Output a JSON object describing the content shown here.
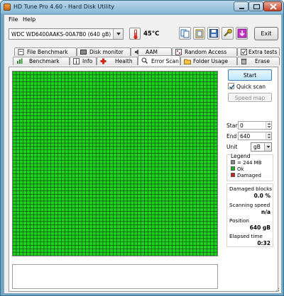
{
  "window": {
    "title": "HD Tune Pro 4.60 - Hard Disk Utility"
  },
  "menu": [
    {
      "label": "File",
      "accel": "F"
    },
    {
      "label": "Help",
      "accel": "H"
    }
  ],
  "toolbar": {
    "drive": "WDC WD6400AAKS-00A7B0 (640 gB)",
    "temperature": "45°C",
    "exit_label": "Exit"
  },
  "tabs_top": [
    "File Benchmark",
    "Disk monitor",
    "AAM",
    "Random Access",
    "Extra tests"
  ],
  "tabs_bottom": [
    "Benchmark",
    "Info",
    "Health",
    "Error Scan",
    "Folder Usage",
    "Erase"
  ],
  "active_tab": "Error Scan",
  "scan": {
    "start_label": "Start",
    "quick_scan_label": "Quick scan",
    "quick_scan_checked": true,
    "speed_map_label": "Speed map",
    "start_field_label": "Start",
    "start_value": "0",
    "end_field_label": "End",
    "end_value": "640",
    "unit_label": "Unit",
    "unit_value": "gB"
  },
  "legend": {
    "title": "Legend",
    "items": [
      {
        "label": "= 244 MB",
        "color": "#8c8c8c"
      },
      {
        "label": "Ok",
        "color": "#1fb21f"
      },
      {
        "label": "Damaged",
        "color": "#c8201a"
      }
    ]
  },
  "stats": {
    "damaged_label": "Damaged blocks",
    "damaged_value": "0.0 %",
    "speed_label": "Scanning speed",
    "speed_value": "n/a",
    "position_label": "Position",
    "position_value": "640 gB",
    "elapsed_label": "Elapsed time",
    "elapsed_value": "0:32"
  },
  "colors": {
    "ok_block": "#1fd21f",
    "grid_line": "#0a3d0a"
  }
}
